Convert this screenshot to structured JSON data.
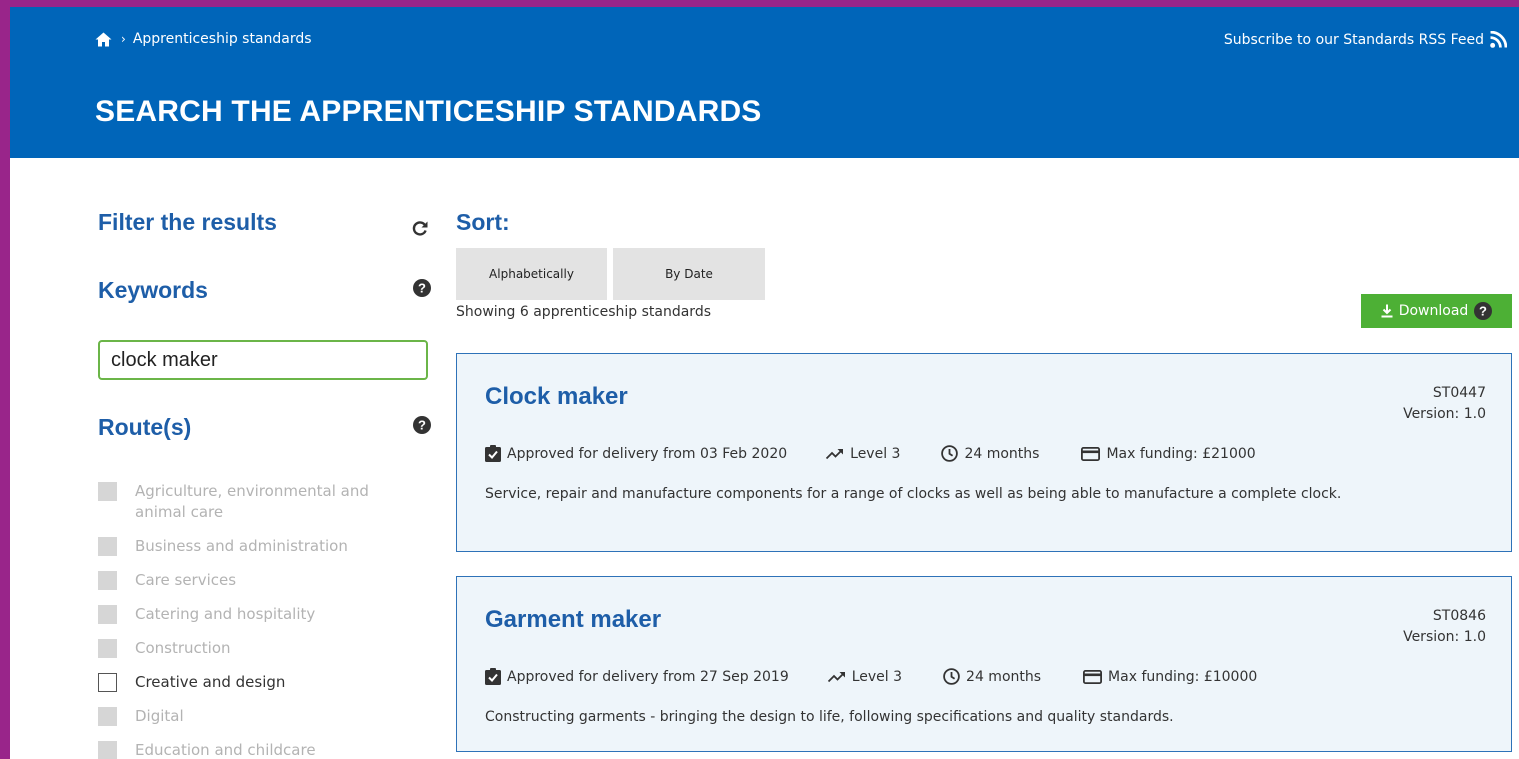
{
  "breadcrumb": {
    "home_icon": "home-icon",
    "current": "Apprenticeship standards"
  },
  "rss": {
    "label": "Subscribe to our Standards RSS Feed",
    "icon": "rss-icon"
  },
  "page_title": "SEARCH THE APPRENTICESHIP STANDARDS",
  "filter": {
    "title": "Filter the results",
    "keywords_label": "Keywords",
    "keywords_value": "clock maker",
    "routes_label": "Route(s)",
    "routes": [
      {
        "label": "Agriculture, environmental and animal care",
        "enabled": false
      },
      {
        "label": "Business and administration",
        "enabled": false
      },
      {
        "label": "Care services",
        "enabled": false
      },
      {
        "label": "Catering and hospitality",
        "enabled": false
      },
      {
        "label": "Construction",
        "enabled": false
      },
      {
        "label": "Creative and design",
        "enabled": true
      },
      {
        "label": "Digital",
        "enabled": false
      },
      {
        "label": "Education and childcare",
        "enabled": false
      }
    ]
  },
  "sort": {
    "label": "Sort:",
    "alphabetically": "Alphabetically",
    "by_date": "By Date"
  },
  "results_count": "Showing 6 apprenticeship standards",
  "download_label": "Download",
  "cards": [
    {
      "title": "Clock maker",
      "id": "ST0447",
      "version": "Version: 1.0",
      "approved": "Approved for delivery from 03 Feb 2020",
      "level": "Level 3",
      "duration": "24 months",
      "funding": "Max funding: £21000",
      "description": "Service, repair and manufacture components for a range of clocks as well as being able to manufacture a complete clock."
    },
    {
      "title": "Garment maker",
      "id": "ST0846",
      "version": "Version: 1.0",
      "approved": "Approved for delivery from 27 Sep 2019",
      "level": "Level 3",
      "duration": "24 months",
      "funding": "Max funding: £10000",
      "description": "Constructing garments - bringing the design to life, following specifications and quality standards."
    }
  ],
  "colors": {
    "frame": "#99258a",
    "header": "#0065b9",
    "heading_blue": "#1e5ea8",
    "input_border": "#6bb548",
    "download": "#4db035",
    "card_bg": "#eef5fa",
    "card_border": "#2e72b8"
  }
}
